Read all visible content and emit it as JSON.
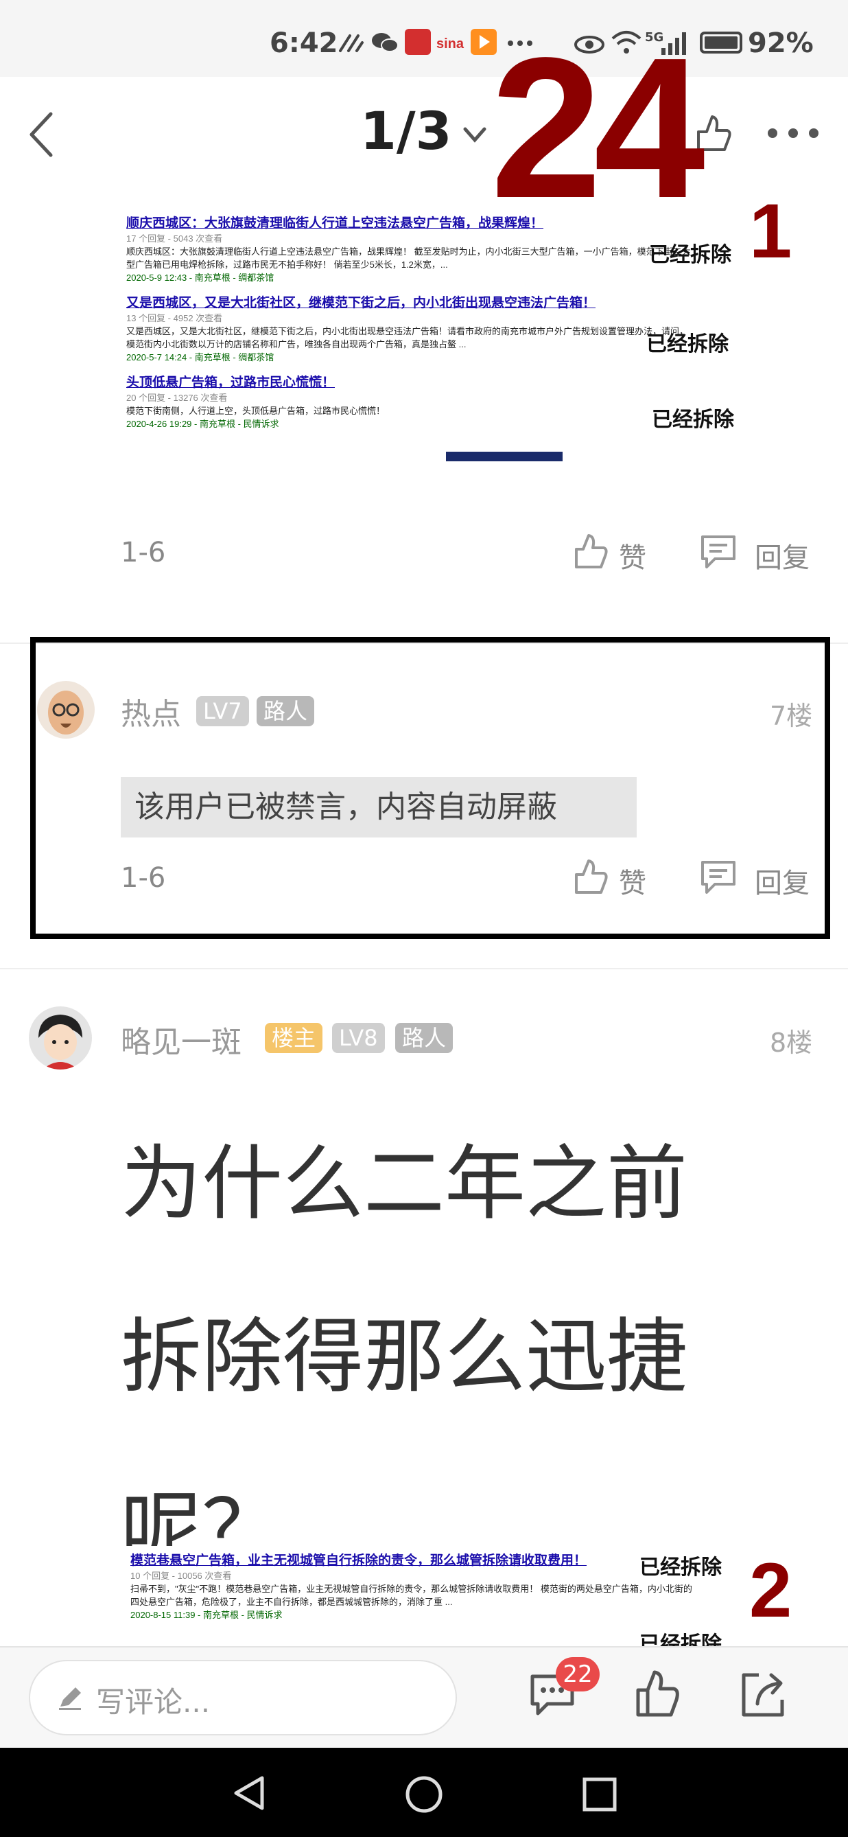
{
  "status_bar": {
    "time": "6:42",
    "network": "5G",
    "battery": "92%"
  },
  "header": {
    "page_indicator": "1/3"
  },
  "overlay": {
    "number": "24",
    "marker1": "1",
    "marker2": "2"
  },
  "post1": {
    "snippets": [
      {
        "title": "顺庆西城区：大张旗鼓清理临街人行道上空违法悬空广告箱，战果辉煌！",
        "meta": "17 个回复 - 5043 次查看",
        "body1": "顺庆西城区：大张旗鼓清理临街人行道上空违法悬空广告箱，战果辉煌！ 截至发贴时为止，内小北街三大型广告箱，一小广告箱，模范下街二大",
        "body2": "型广告箱已用电焊枪拆除，过路市民无不拍手称好！ 倘若至少5米长，1.2米宽，...",
        "date": "2020-5-9 12:43 - 南充草根 - 绸都茶馆",
        "stamp": "已经拆除"
      },
      {
        "title": "又是西城区，又是大北街社区，继模范下街之后，内小北街出现悬空违法广告箱！",
        "meta": "13 个回复 - 4952 次查看",
        "body1": "又是西城区，又是大北街社区，继模范下街之后，内小北街出现悬空违法广告箱！请看市政府的南充市城市户外广告规划设置管理办法，请问，",
        "body2": "模范街内小北街数以万计的店铺名称和广告，唯独各自出现两个广告箱，真是独占鳌 ...",
        "date": "2020-5-7 14:24 - 南充草根 - 绸都茶馆",
        "stamp": "已经拆除"
      },
      {
        "title": "头顶低悬广告箱，过路市民心慌慌！",
        "meta": "20 个回复 - 13276 次查看",
        "body1": "模范下街南侧，人行道上空，头顶低悬广告箱，过路市民心慌慌！",
        "body2": "",
        "date": "2020-4-26 19:29 - 南充草根 - 民情诉求",
        "stamp": "已经拆除"
      }
    ],
    "date_range": "1-6",
    "like_label": "赞",
    "reply_label": "回复"
  },
  "post2": {
    "username": "热点",
    "level": "LV7",
    "role": "路人",
    "floor": "7楼",
    "content": "该用户已被禁言，内容自动屏蔽",
    "date_range": "1-6",
    "like_label": "赞",
    "reply_label": "回复"
  },
  "post3": {
    "username": "略见一斑",
    "owner_badge": "楼主",
    "level": "LV8",
    "role": "路人",
    "floor": "8楼",
    "content_line1": "为什么二年之前",
    "content_line2": "拆除得那么迅捷",
    "content_line3": "呢？",
    "snippet": {
      "title": "模范巷悬空广告箱，业主无视城管自行拆除的责令，那么城管拆除请收取费用！",
      "meta": "10 个回复 - 10056 次查看",
      "body1": "扫帚不到，\"灰尘\"不跑！模范巷悬空广告箱，业主无视城管自行拆除的责令，那么城管拆除请收取费用！ 模范街的两处悬空广告箱，内小北街的",
      "body2": "四处悬空广告箱，危险极了，业主不自行拆除，都是西城城管拆除的，消除了重 ...",
      "date": "2020-8-15 11:39 - 南充草根 - 民情诉求",
      "stamp1": "已经拆除",
      "stamp2": "已经拆除"
    }
  },
  "bottom_bar": {
    "comment_placeholder": "写评论...",
    "comment_count": "22"
  },
  "colors": {
    "accent_red": "#e94a4a",
    "owner_badge": "#f5c56a",
    "level_badge": "#cfcfcf",
    "overlay_red": "#8b0000"
  }
}
